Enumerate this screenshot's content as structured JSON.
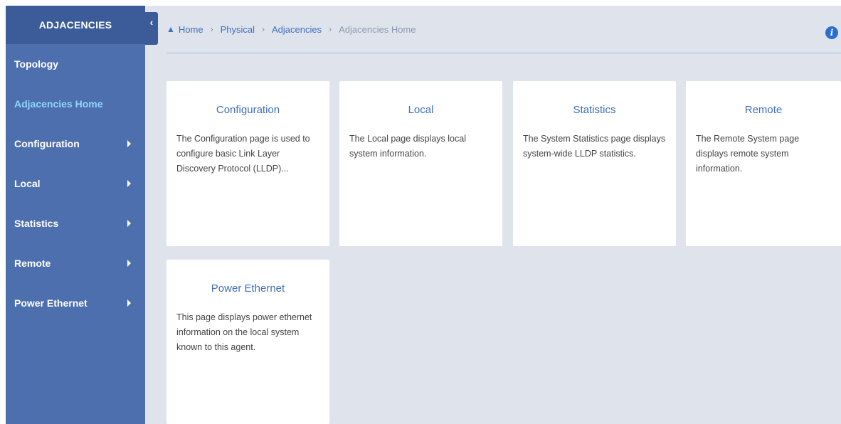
{
  "sidebar": {
    "header": "ADJACENCIES",
    "items": [
      {
        "label": "Topology",
        "has_submenu": false,
        "active": false
      },
      {
        "label": "Adjacencies Home",
        "has_submenu": false,
        "active": true
      },
      {
        "label": "Configuration",
        "has_submenu": true,
        "active": false
      },
      {
        "label": "Local",
        "has_submenu": true,
        "active": false
      },
      {
        "label": "Statistics",
        "has_submenu": true,
        "active": false
      },
      {
        "label": "Remote",
        "has_submenu": true,
        "active": false
      },
      {
        "label": "Power Ethernet",
        "has_submenu": true,
        "active": false
      }
    ]
  },
  "collapse_icon": "chevron-left-icon",
  "breadcrumb": {
    "home": "Home",
    "physical": "Physical",
    "adjacencies": "Adjacencies",
    "current": "Adjacencies Home"
  },
  "cards": [
    {
      "title": "Configuration",
      "description": "The Configuration page is used to configure basic Link Layer Discovery Protocol (LLDP)..."
    },
    {
      "title": "Local",
      "description": "The Local page displays local system information."
    },
    {
      "title": "Statistics",
      "description": "The System Statistics page displays system-wide LLDP statistics."
    },
    {
      "title": "Remote",
      "description": "The Remote System page displays remote system information."
    },
    {
      "title": "Power Ethernet",
      "description": "This page displays power ethernet information on the local system known to this agent."
    }
  ],
  "colors": {
    "sidebar_bg": "#4d6fae",
    "sidebar_header_bg": "#3b5c99",
    "active_item": "#8fd6ff",
    "link": "#3f6fbb",
    "main_bg": "#dfe4ec"
  }
}
